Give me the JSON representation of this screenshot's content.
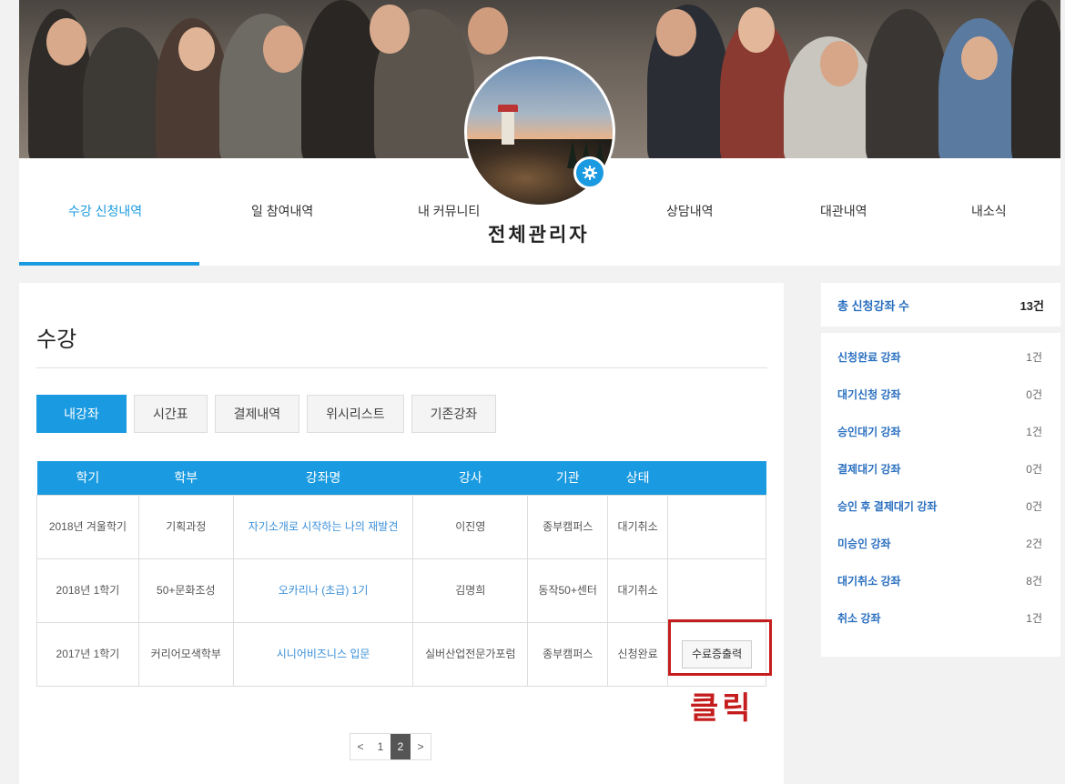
{
  "nav": {
    "tabs": [
      "수강 신청내역",
      "일 참여내역",
      "내 커뮤니티",
      "상담내역",
      "대관내역",
      "내소식"
    ],
    "active": 0,
    "user_name": "전체관리자"
  },
  "icons": {
    "settings": "gear-icon"
  },
  "colors": {
    "accent": "#1a9ae0",
    "highlight": "#c51d1d",
    "side_label": "#2a6fbf"
  },
  "section": {
    "title": "수강",
    "subtabs": [
      "내강좌",
      "시간표",
      "결제내역",
      "위시리스트",
      "기존강좌"
    ],
    "active_subtab": 0
  },
  "table": {
    "headers": [
      "학기",
      "학부",
      "강좌명",
      "강사",
      "기관",
      "상태"
    ],
    "rows": [
      {
        "term": "2018년 겨울학기",
        "dept": "기획과정",
        "course": "자기소개로 시작하는 나의 재발견",
        "teacher": "이진영",
        "org": "종부캠퍼스",
        "status": "대기취소",
        "action": ""
      },
      {
        "term": "2018년 1학기",
        "dept": "50+문화조성",
        "course": "오카리나 (초급) 1기",
        "teacher": "김명희",
        "org": "동작50+센터",
        "status": "대기취소",
        "action": ""
      },
      {
        "term": "2017년 1학기",
        "dept": "커리어모색학부",
        "course": "시니어비즈니스 입문",
        "teacher": "실버산업전문가포럼",
        "org": "종부캠퍼스",
        "status": "신청완료",
        "action": "수료증출력"
      }
    ]
  },
  "annotation": {
    "click_label": "클릭"
  },
  "pagination": {
    "prev": "<",
    "pages": [
      "1",
      "2"
    ],
    "current": "2",
    "next": ">"
  },
  "summary": {
    "total_label": "총 신청강좌 수",
    "total_value": "13건",
    "items": [
      {
        "label": "신청완료 강좌",
        "value": "1건"
      },
      {
        "label": "대기신청 강좌",
        "value": "0건"
      },
      {
        "label": "승인대기 강좌",
        "value": "1건"
      },
      {
        "label": "결제대기 강좌",
        "value": "0건"
      },
      {
        "label": "승인 후 결제대기 강좌",
        "value": "0건"
      },
      {
        "label": "미승인 강좌",
        "value": "2건"
      },
      {
        "label": "대기취소 강좌",
        "value": "8건"
      },
      {
        "label": "취소 강좌",
        "value": "1건"
      }
    ]
  }
}
